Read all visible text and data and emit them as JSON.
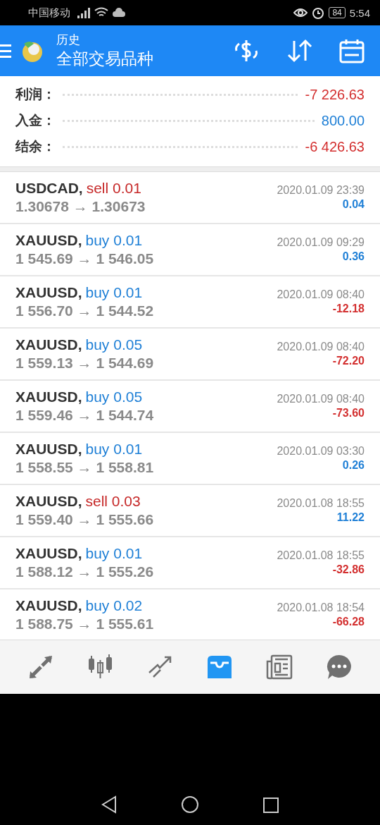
{
  "status_bar": {
    "carrier": "中国移动",
    "battery": "84",
    "time": "5:54"
  },
  "header": {
    "subtitle": "历史",
    "title": "全部交易品种"
  },
  "summary": [
    {
      "label": "利润：",
      "value": "-7 226.63",
      "negative": true
    },
    {
      "label": "入金：",
      "value": "800.00",
      "negative": false
    },
    {
      "label": "结余：",
      "value": "-6 426.63",
      "negative": true
    }
  ],
  "trades": [
    {
      "symbol": "USDCAD,",
      "sell": true,
      "action": "sell 0.01",
      "prices": "1.30678 → 1.30673",
      "time": "2020.01.09 23:39",
      "profit": "0.04",
      "negative": false
    },
    {
      "symbol": "XAUUSD,",
      "sell": false,
      "action": "buy 0.01",
      "prices": "1 545.69 → 1 546.05",
      "time": "2020.01.09 09:29",
      "profit": "0.36",
      "negative": false
    },
    {
      "symbol": "XAUUSD,",
      "sell": false,
      "action": "buy 0.01",
      "prices": "1 556.70 → 1 544.52",
      "time": "2020.01.09 08:40",
      "profit": "-12.18",
      "negative": true
    },
    {
      "symbol": "XAUUSD,",
      "sell": false,
      "action": "buy 0.05",
      "prices": "1 559.13 → 1 544.69",
      "time": "2020.01.09 08:40",
      "profit": "-72.20",
      "negative": true
    },
    {
      "symbol": "XAUUSD,",
      "sell": false,
      "action": "buy 0.05",
      "prices": "1 559.46 → 1 544.74",
      "time": "2020.01.09 08:40",
      "profit": "-73.60",
      "negative": true
    },
    {
      "symbol": "XAUUSD,",
      "sell": false,
      "action": "buy 0.01",
      "prices": "1 558.55 → 1 558.81",
      "time": "2020.01.09 03:30",
      "profit": "0.26",
      "negative": false
    },
    {
      "symbol": "XAUUSD,",
      "sell": true,
      "action": "sell 0.03",
      "prices": "1 559.40 → 1 555.66",
      "time": "2020.01.08 18:55",
      "profit": "11.22",
      "negative": false
    },
    {
      "symbol": "XAUUSD,",
      "sell": false,
      "action": "buy 0.01",
      "prices": "1 588.12 → 1 555.26",
      "time": "2020.01.08 18:55",
      "profit": "-32.86",
      "negative": true
    },
    {
      "symbol": "XAUUSD,",
      "sell": false,
      "action": "buy 0.02",
      "prices": "1 588.75 → 1 555.61",
      "time": "2020.01.08 18:54",
      "profit": "-66.28",
      "negative": true
    }
  ],
  "bottom_nav": [
    {
      "selected": false
    },
    {
      "selected": false
    },
    {
      "selected": false
    },
    {
      "selected": true
    },
    {
      "selected": false
    },
    {
      "selected": false
    }
  ]
}
